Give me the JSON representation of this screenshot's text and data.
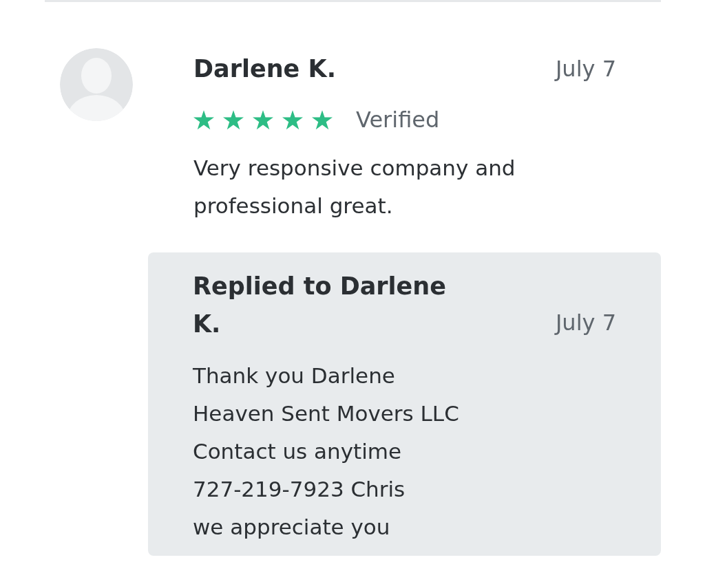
{
  "review": {
    "author": "Darlene K.",
    "date": "July 7",
    "stars": 5,
    "badge": "Verified",
    "text": "Very responsive company and professional great."
  },
  "reply": {
    "title": "Replied to Darlene K.",
    "date": "July 7",
    "lines": [
      "Thank you Darlene",
      "Heaven Sent Movers LLC",
      "Contact us anytime",
      "727-219-7923 Chris",
      "we appreciate you"
    ]
  }
}
